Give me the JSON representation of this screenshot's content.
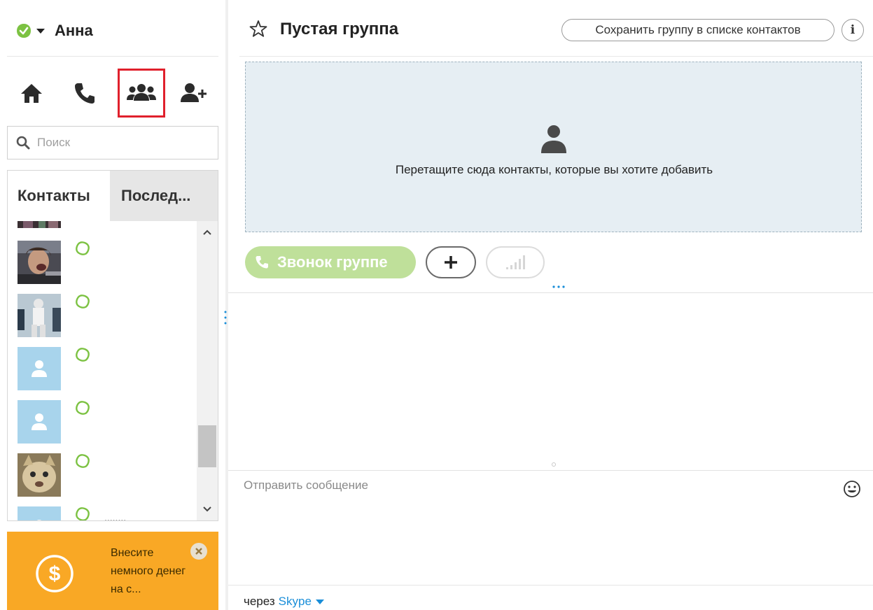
{
  "profile": {
    "name": "Анна",
    "status_icon": "skype-online-icon"
  },
  "nav": {
    "home_icon": "home-icon",
    "call_icon": "phone-icon",
    "groups_icon": "group-icon",
    "add_contact_icon": "add-contact-icon",
    "selected": "groups"
  },
  "search": {
    "placeholder": "Поиск",
    "icon": "search-icon"
  },
  "tabs": {
    "contacts": "Контакты",
    "recent": "Послед..."
  },
  "contacts": [
    {
      "avatar": "photo-dark",
      "status": "online"
    },
    {
      "avatar": "photo-singer",
      "status": "online"
    },
    {
      "avatar": "photo-figure",
      "status": "online"
    },
    {
      "avatar": "default-avatar",
      "status": "online"
    },
    {
      "avatar": "default-avatar",
      "status": "online"
    },
    {
      "avatar": "photo-cat",
      "status": "online"
    },
    {
      "avatar": "default-avatar",
      "status": "online",
      "label": "........"
    }
  ],
  "promo": {
    "text": "Внесите немного денег на с...",
    "icon": "dollar-icon"
  },
  "chat": {
    "title": "Пустая группа",
    "save_group_label": "Сохранить группу в списке контактов",
    "info_label": "i",
    "dropzone_text": "Перетащите сюда контакты, которые вы хотите добавить",
    "call_group_label": "Звонок группе",
    "message_placeholder": "Отправить сообщение",
    "via_label": "через",
    "via_service": "Skype"
  },
  "colors": {
    "accent_green": "#bfe09a",
    "skype_blue": "#1a8ed8",
    "promo_orange": "#f9a825",
    "selection_red": "#e0202c",
    "dropzone_bg": "#e6eef3"
  }
}
